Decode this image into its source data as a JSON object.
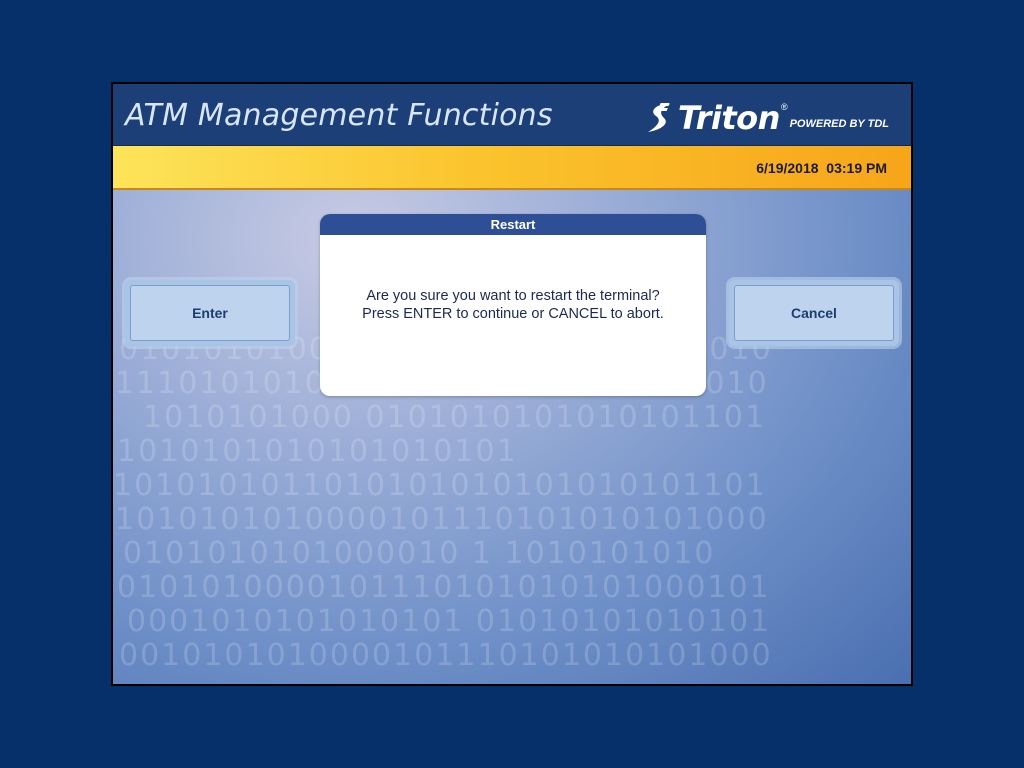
{
  "header": {
    "title": "ATM Management Functions",
    "brand_name": "Triton",
    "brand_reg": "®",
    "brand_powered": "POWERED BY TDL"
  },
  "status": {
    "datetime": "6/19/2018  03:19 PM"
  },
  "buttons": {
    "enter_label": "Enter",
    "cancel_label": "Cancel"
  },
  "dialog": {
    "title": "Restart",
    "line1": "Are you sure you want to restart the terminal?",
    "line2": "Press ENTER to continue or CANCEL to abort."
  },
  "colors": {
    "outer_background": "#05306a",
    "header_background": "#1c3f78",
    "status_bar_start": "#fde45a",
    "status_bar_end": "#f7a51a",
    "dialog_titlebar": "#2e4f96",
    "button_text": "#1f3e70"
  }
}
